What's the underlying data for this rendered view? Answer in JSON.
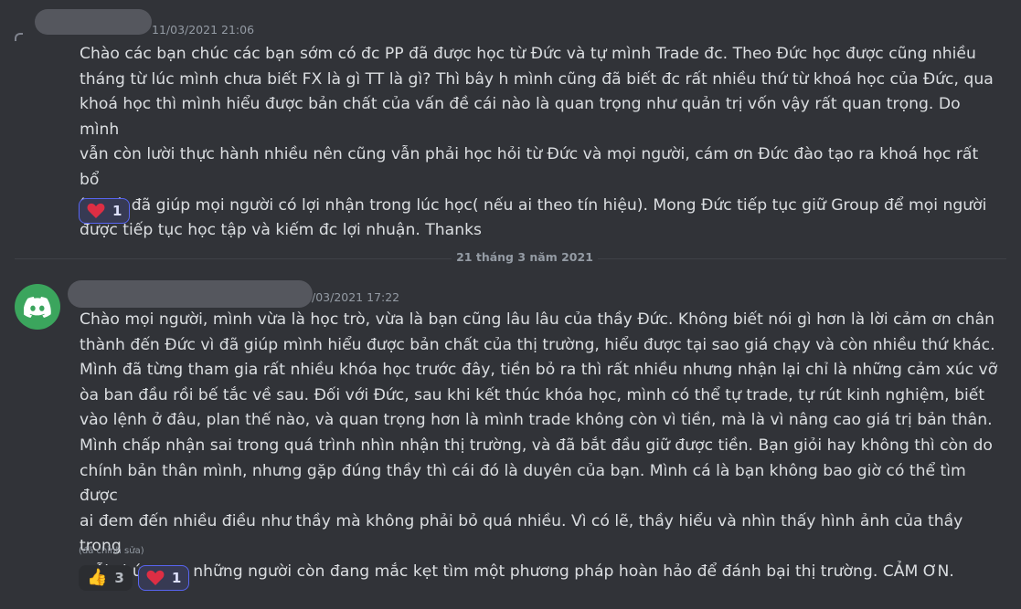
{
  "message1": {
    "timestamp": "11/03/2021 21:06",
    "content": "Chào các bạn chúc các bạn sớm có đc PP đã được học từ Đức và tự mình Trade đc. Theo Đức học được cũng nhiều\ntháng từ lúc mình chưa biết FX là gì TT là gì? Thì bây h mình cũng đã biết đc rất nhiều thứ từ khoá học của Đức, qua\nkhoá học thì mình hiểu được bản chất của vấn đề cái nào là quan trọng như quản trị vốn vậy rất quan trọng. Do mình\nvẫn còn lười thực hành nhiều nên cũng vẫn phải học hỏi từ Đức và mọi người, cám ơn Đức đào tạo ra khoá học rất bổ\ních và đã giúp mọi người có lợi nhận trong lúc học( nếu ai theo tín hiệu). Mong  Đức tiếp tục giữ Group để mọi người\nđược tiếp tục học tập và kiếm đc lợi nhuận. Thanks",
    "reactions": [
      {
        "emoji": "heart-icon",
        "count": "1",
        "me": true
      }
    ]
  },
  "divider": {
    "label": "21 tháng 3 năm 2021"
  },
  "message2": {
    "timestamp": "/03/2021 17:22",
    "avatar_icon": "discord-logo-icon",
    "avatar_color": "#3ba55d",
    "content": "Chào mọi người, mình vừa là học trò, vừa là bạn cũng lâu lâu của thầy Đức. Không biết nói gì hơn là lời cảm ơn chân\nthành đến Đức vì đã giúp mình hiểu được bản chất của thị trường, hiểu được tại sao giá chạy và còn nhiều thứ khác.\nMình đã từng tham gia rất nhiều khóa học trước đây, tiền bỏ ra thì rất nhiều nhưng nhận lại chỉ là những cảm xúc vỡ\nòa ban đầu rồi bế tắc về sau. Đối với Đức, sau khi kết thúc khóa học, mình có thể tự trade, tự rút kinh nghiệm, biết\nvào lệnh ở đâu, plan thế nào, và quan trọng hơn là mình trade không còn vì tiền, mà là vì nâng cao giá trị bản thân.\nMình chấp nhận sai trong quá trình nhìn nhận thị trường, và đã bắt đầu giữ được tiền. Bạn giỏi hay không thì còn do\nchính bản thân mình, nhưng gặp đúng thầy thì cái đó là duyên của bạn. Mình cá là bạn không bao giờ có thể tìm được\nai đem đến nhiều điều như thầy mà không phải bỏ quá nhiều. Vì có lẽ, thầy hiểu và nhìn thấy hình ảnh của thầy trong\nmỗi chúng ta, những người còn đang mắc kẹt tìm một phương pháp hoàn hảo để đánh bại thị trường. CẢM ƠN.",
    "edited_label": "(đã chỉnh sửa)",
    "reactions": [
      {
        "emoji": "thumbs-up-icon",
        "count": "3",
        "me": false
      },
      {
        "emoji": "heart-icon",
        "count": "1",
        "me": true
      }
    ]
  },
  "colors": {
    "background": "#313338",
    "text": "#dbdee1",
    "muted": "#949ba4",
    "reaction_active_border": "#5865f2"
  }
}
